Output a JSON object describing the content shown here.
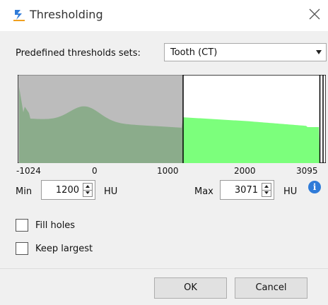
{
  "window": {
    "title": "Thresholding",
    "app_icon": "logo-icon",
    "close_icon": "close-icon"
  },
  "presets": {
    "label": "Predefined thresholds sets:",
    "selected": "Tooth (CT)"
  },
  "histogram": {
    "range": [
      -1024,
      3095
    ],
    "tick_labels": [
      "-1024",
      "0",
      "1000",
      "2000",
      "3095"
    ],
    "selection": [
      1200,
      3071
    ],
    "colors": {
      "selected": "#3fbf3f",
      "unselected": "#7cff7c",
      "shade": "#a6a6a6",
      "marker": "#000000"
    }
  },
  "min": {
    "label": "Min",
    "value": "1200",
    "unit": "HU"
  },
  "max": {
    "label": "Max",
    "value": "3071",
    "unit": "HU"
  },
  "info_icon": "info-icon",
  "options": {
    "fill_holes": {
      "label": "Fill holes",
      "checked": false
    },
    "keep_largest": {
      "label": "Keep largest",
      "checked": false
    }
  },
  "buttons": {
    "ok": "OK",
    "cancel": "Cancel"
  }
}
